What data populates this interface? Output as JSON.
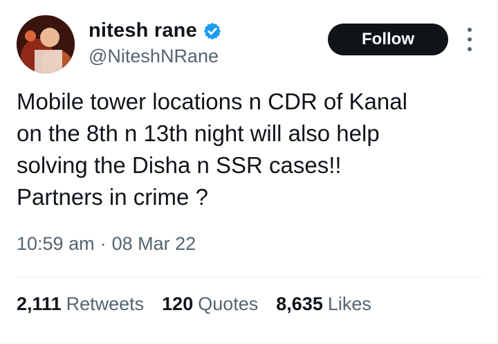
{
  "author": {
    "name": "nitesh rane",
    "handle": "@NiteshNRane",
    "verified_color": "#1d9bf0"
  },
  "follow_label": "Follow",
  "tweet": {
    "lines": [
      "Mobile tower locations n CDR of Kanal",
      "on the 8th n 13th night will also help",
      "solving the Disha n SSR cases!!",
      "Partners in crime ?"
    ]
  },
  "meta": {
    "time": "10:59 am",
    "separator": "·",
    "date": "08 Mar 22"
  },
  "stats": [
    {
      "count": "2,111",
      "label": "Retweets"
    },
    {
      "count": "120",
      "label": "Quotes"
    },
    {
      "count": "8,635",
      "label": "Likes"
    }
  ],
  "icons": {
    "verified": "verified-badge-icon",
    "more": "more-vertical-icon"
  }
}
